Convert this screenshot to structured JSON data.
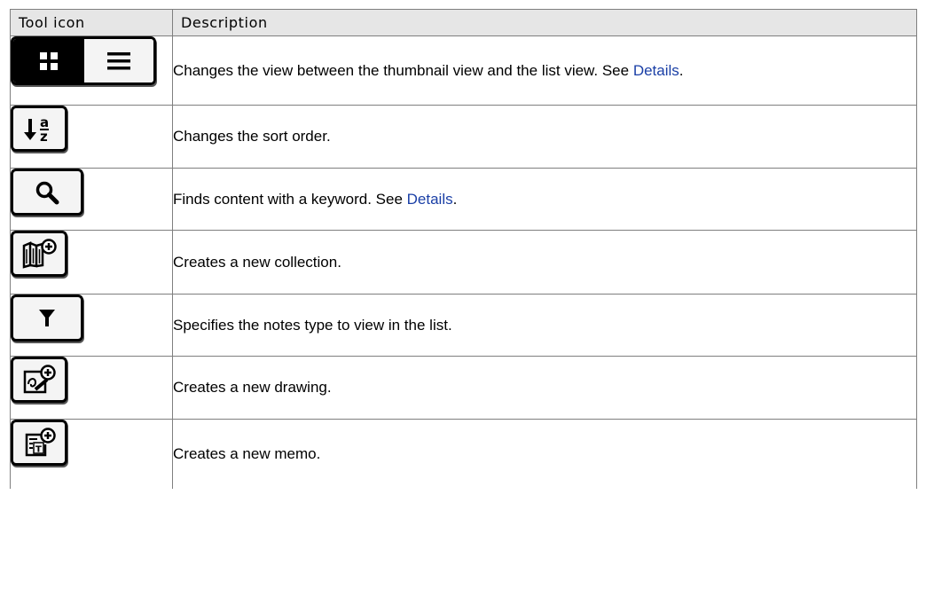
{
  "table": {
    "header": {
      "tool_icon": "Tool icon",
      "description": "Description"
    },
    "rows": [
      {
        "icon": "view-toggle-icon",
        "text": "Changes the view between the thumbnail view and the list view. See ",
        "link": "Details",
        "suffix": "."
      },
      {
        "icon": "sort-order-icon",
        "text": "Changes the sort order."
      },
      {
        "icon": "search-icon",
        "text": "Finds content with a keyword. See ",
        "link": "Details",
        "suffix": "."
      },
      {
        "icon": "new-collection-icon",
        "text": "Creates a new collection."
      },
      {
        "icon": "filter-icon",
        "text": "Specifies the notes type to view in the list."
      },
      {
        "icon": "new-drawing-icon",
        "text": "Creates a new drawing."
      },
      {
        "icon": "new-memo-icon",
        "text": "Creates a new memo."
      }
    ]
  },
  "icon_glyphs": {
    "sort_a": "a",
    "sort_z": "z",
    "memo_t": "T"
  },
  "colors": {
    "link": "#1a3fa6",
    "header_bg": "#e6e6e6",
    "border": "#7f7f7f"
  }
}
